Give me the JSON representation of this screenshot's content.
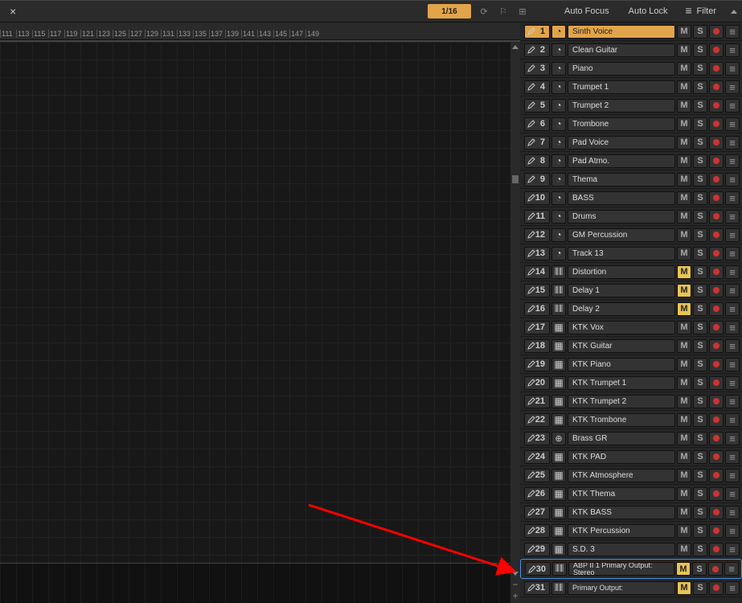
{
  "toolbar": {
    "grid": "1/16",
    "auto_focus": "Auto Focus",
    "auto_lock": "Auto Lock",
    "filter": "Filter"
  },
  "ruler_start": 111,
  "ruler_step": 2,
  "ruler_count": 20,
  "tracks": [
    {
      "num": "1",
      "type": "midi",
      "name": "Sinth Voice",
      "selected": true,
      "m": false,
      "m_active": false
    },
    {
      "num": "2",
      "type": "midi",
      "name": "Clean Guitar",
      "selected": false,
      "m": false
    },
    {
      "num": "3",
      "type": "midi",
      "name": "Piano",
      "selected": false,
      "m": false
    },
    {
      "num": "4",
      "type": "midi",
      "name": "Trumpet 1",
      "selected": false,
      "m": false
    },
    {
      "num": "5",
      "type": "midi",
      "name": "Trumpet 2",
      "selected": false,
      "m": false
    },
    {
      "num": "6",
      "type": "midi",
      "name": "Trombone",
      "selected": false,
      "m": false
    },
    {
      "num": "7",
      "type": "midi",
      "name": "Pad Voice",
      "selected": false,
      "m": false
    },
    {
      "num": "8",
      "type": "midi",
      "name": "Pad Atmo.",
      "selected": false,
      "m": false
    },
    {
      "num": "9",
      "type": "midi",
      "name": "Thema",
      "selected": false,
      "m": false
    },
    {
      "num": "10",
      "type": "midi",
      "name": "BASS",
      "selected": false,
      "m": false
    },
    {
      "num": "11",
      "type": "midi",
      "name": "Drums",
      "selected": false,
      "m": false
    },
    {
      "num": "12",
      "type": "midi",
      "name": "GM Percussion",
      "selected": false,
      "m": false
    },
    {
      "num": "13",
      "type": "midi",
      "name": "Track 13",
      "selected": false,
      "m": false
    },
    {
      "num": "14",
      "type": "audio",
      "name": "Distortion",
      "selected": false,
      "m": true
    },
    {
      "num": "15",
      "type": "audio",
      "name": "Delay 1",
      "selected": false,
      "m": true
    },
    {
      "num": "16",
      "type": "audio",
      "name": "Delay 2",
      "selected": false,
      "m": true
    },
    {
      "num": "17",
      "type": "inst",
      "name": "KTK Vox",
      "selected": false,
      "m": false
    },
    {
      "num": "18",
      "type": "inst",
      "name": "KTK Guitar",
      "selected": false,
      "m": false
    },
    {
      "num": "19",
      "type": "inst",
      "name": "KTK Piano",
      "selected": false,
      "m": false
    },
    {
      "num": "20",
      "type": "inst",
      "name": "KTK Trumpet 1",
      "selected": false,
      "m": false
    },
    {
      "num": "21",
      "type": "inst",
      "name": "KTK Trumpet 2",
      "selected": false,
      "m": false
    },
    {
      "num": "22",
      "type": "inst",
      "name": "KTK Trombone",
      "selected": false,
      "m": false
    },
    {
      "num": "23",
      "type": "bus",
      "name": "Brass GR",
      "selected": false,
      "m": false
    },
    {
      "num": "24",
      "type": "inst",
      "name": "KTK PAD",
      "selected": false,
      "m": false
    },
    {
      "num": "25",
      "type": "inst",
      "name": "KTK Atmosphere",
      "selected": false,
      "m": false
    },
    {
      "num": "26",
      "type": "inst",
      "name": "KTK Thema",
      "selected": false,
      "m": false
    },
    {
      "num": "27",
      "type": "inst",
      "name": "KTK BASS",
      "selected": false,
      "m": false
    },
    {
      "num": "28",
      "type": "inst",
      "name": "KTK Percussion",
      "selected": false,
      "m": false
    },
    {
      "num": "29",
      "type": "inst2",
      "name": "S.D. 3",
      "selected": false,
      "m": false
    },
    {
      "num": "30",
      "type": "audio",
      "name": "ABP II 1 Primary Output: Stereo",
      "selected": false,
      "m": true,
      "highlighted": true,
      "small": true
    },
    {
      "num": "31",
      "type": "audio",
      "name": "Primary Output:",
      "selected": false,
      "m": true,
      "small": true
    }
  ]
}
